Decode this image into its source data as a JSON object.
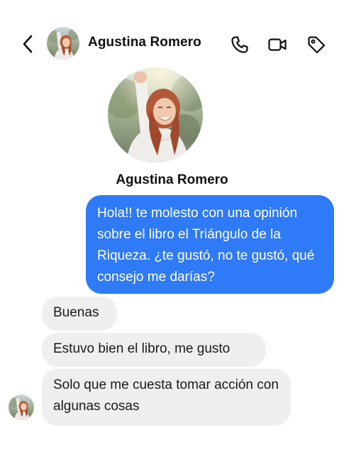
{
  "header": {
    "contact_name": "Agustina Romero"
  },
  "icons": {
    "back": "chevron-left-icon",
    "call": "phone-icon",
    "video": "video-camera-icon",
    "tag": "tag-icon"
  },
  "profile": {
    "name": "Agustina Romero"
  },
  "messages": [
    {
      "direction": "outgoing",
      "text": "Hola!! te molesto con una opinión sobre el libro el Triángulo de la Riqueza. ¿te gustó, no te gustó, qué consejo me darías?"
    },
    {
      "direction": "incoming",
      "text": "Buenas"
    },
    {
      "direction": "incoming",
      "text": "Estuvo bien el libro, me gusto"
    },
    {
      "direction": "incoming",
      "text": "Solo que me cuesta tomar acción con algunas cosas"
    }
  ],
  "colors": {
    "outgoing_bubble": "#2f7af6",
    "incoming_bubble": "#efefef",
    "outgoing_text": "#ffffff",
    "incoming_text": "#1a1a1a"
  }
}
